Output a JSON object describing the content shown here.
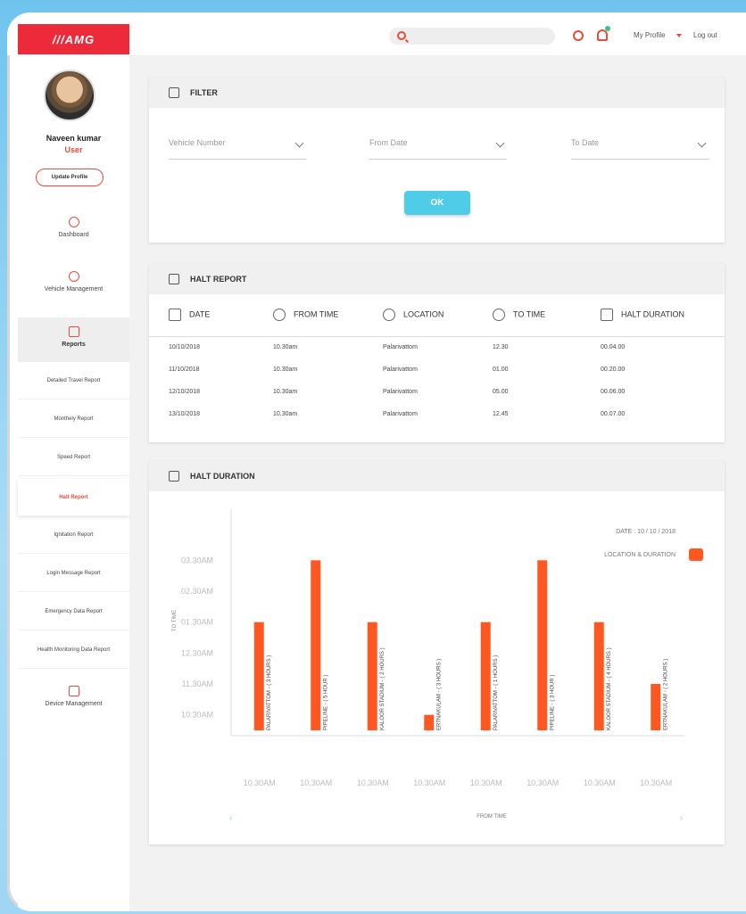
{
  "header": {
    "logo": "///AMG",
    "search_placeholder": "",
    "my_profile": "My Profile",
    "logout": "Log out"
  },
  "sidebar": {
    "user_name": "Naveen kumar",
    "user_role": "User",
    "update_profile": "Update Profile",
    "dashboard": "Dashboard",
    "vehicle_management": "Vehicle Management",
    "reports": "Reports",
    "sub_items": [
      "Detailed Travel Report",
      "Monthely Report",
      "Speed Report",
      "Halt Report",
      "Ignitation Report",
      "Login Message Report",
      "Emergency Data Report",
      "Health Monitoring Data Report"
    ],
    "device_management": "Device Management"
  },
  "filter": {
    "title": "FILTER",
    "vehicle_number": "Vehicle Number",
    "from_date": "From Date",
    "to_date": "To Date",
    "ok": "OK"
  },
  "halt_report": {
    "title": "HALT REPORT",
    "columns": [
      "DATE",
      "FROM TIME",
      "LOCATION",
      "TO TIME",
      "HALT DURATION"
    ],
    "rows": [
      [
        "10/10/2018",
        "10.30am",
        "Palarivattom",
        "12.30",
        "00.04.00"
      ],
      [
        "11/10/2018",
        "10.30am",
        "Palarivattom",
        "01.00",
        "00.20.00"
      ],
      [
        "12/10/2018",
        "10.30am",
        "Palarivattom",
        "05.00",
        "00.06.00"
      ],
      [
        "13/10/2018",
        "10.30am",
        "Palarivattom",
        "12.45",
        "00.07.00"
      ]
    ]
  },
  "halt_duration": {
    "title": "HALT DURATION"
  },
  "chart_data": {
    "type": "bar",
    "title": "",
    "date_label": "DATE : 10 / 10 / 2018",
    "legend": "LOCATION & DURATION",
    "xlabel": "FROM TIME",
    "ylabel": "TO TIME",
    "y_ticks": [
      "10.30AM",
      "11.30AM",
      "12.30AM",
      "01.30AM",
      "02.30AM",
      "03.30AM"
    ],
    "categories": [
      "10.30AM",
      "10.30AM",
      "10.30AM",
      "10.30AM",
      "10.30AM",
      "10.30AM",
      "10.30AM",
      "10.30AM"
    ],
    "bar_labels": [
      "PALARIVATTOM - ( 3 HOURS )",
      "PIPELINE - ( 5 HOUR )",
      "KALOOR STADIUM - ( 2 HOURS )",
      "ERTNAKULAM - ( 3 HOURS )",
      "PALARIVATTOM - ( 1 HOURS )",
      "PIPELINE - ( 3 HOUR )",
      "KALOOR STADIUM - ( 4 HOURS )",
      "ERTNAKULAM - ( 2 HOURS )"
    ],
    "values": [
      3.5,
      5.5,
      3.5,
      0.5,
      3.5,
      5.5,
      3.5,
      1.5
    ],
    "ylim": [
      0,
      6
    ],
    "colors": {
      "bar": "#ff5722",
      "legend": "#ff5722"
    }
  }
}
